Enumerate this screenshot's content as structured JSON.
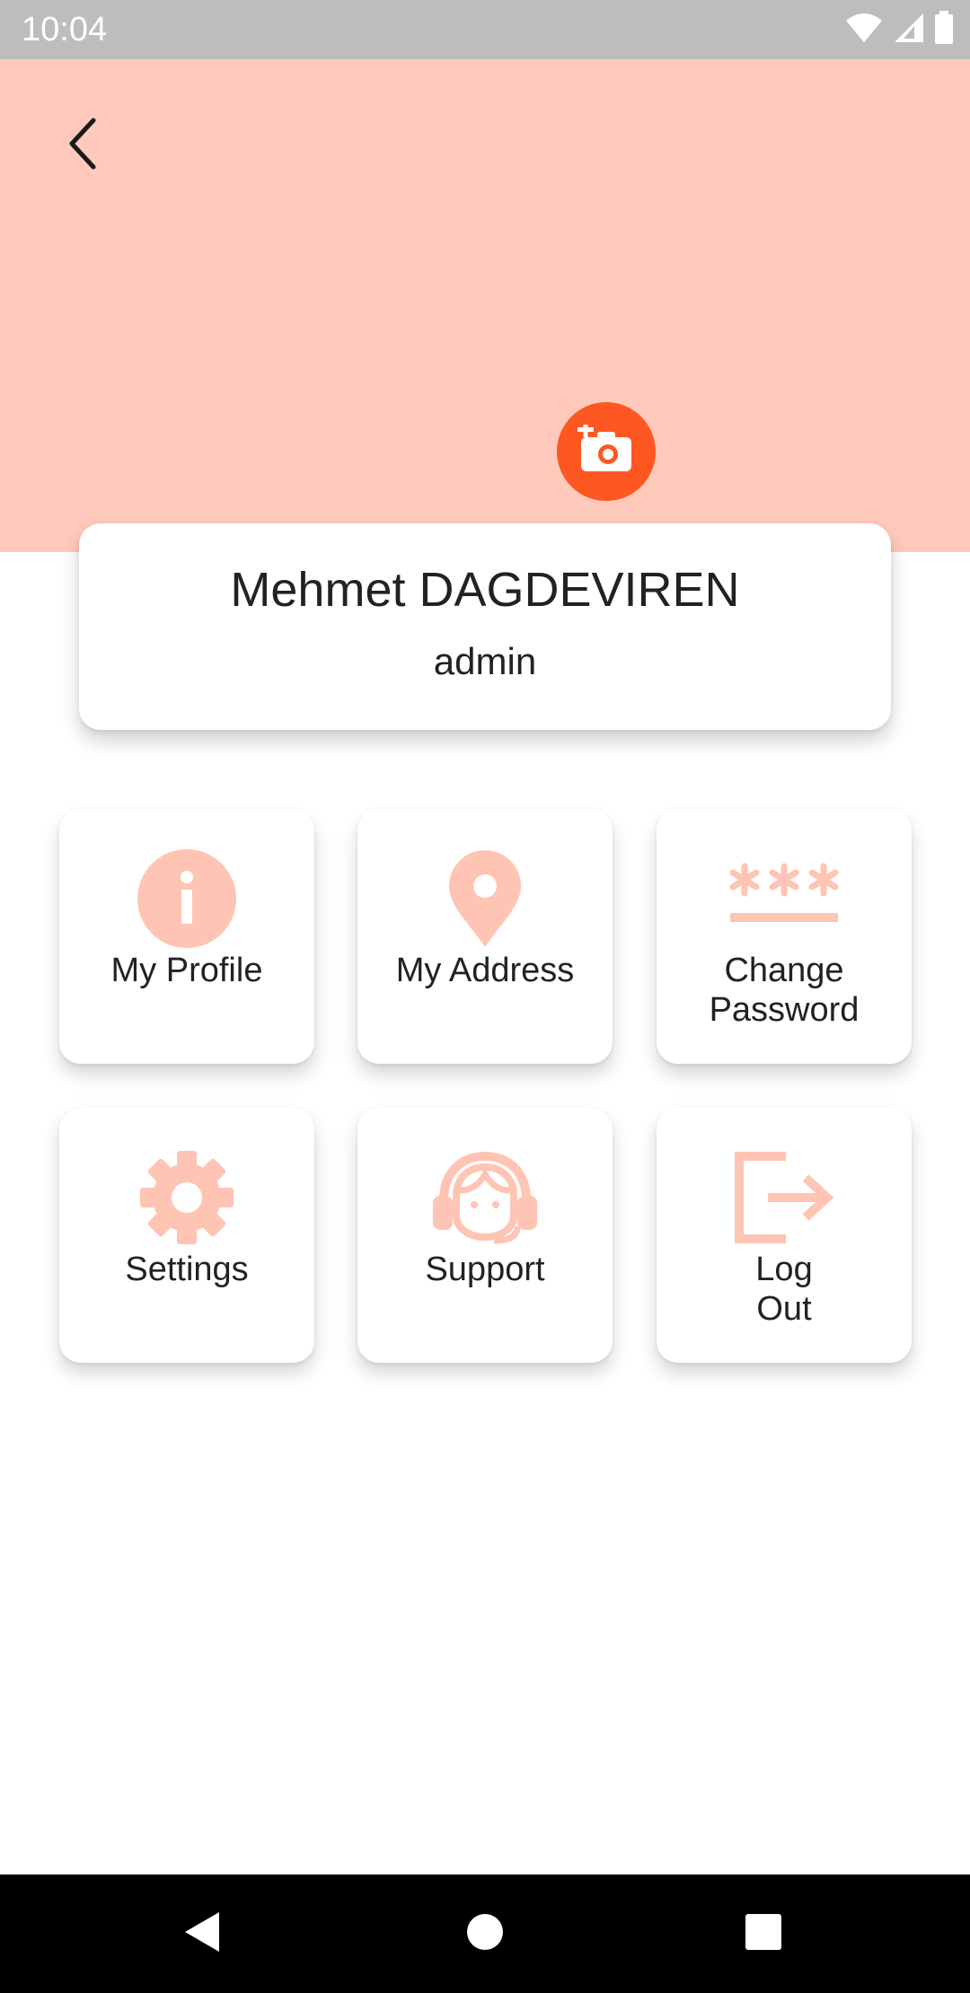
{
  "status_bar": {
    "time": "10:04",
    "icons": [
      "wifi-icon",
      "cell-signal-icon",
      "battery-icon"
    ]
  },
  "header": {
    "back_icon": "chevron-left-icon",
    "camera_icon": "add-photo-camera-icon"
  },
  "profile": {
    "name": "Mehmet DAGDEVIREN",
    "role": "admin"
  },
  "menu": {
    "items": [
      {
        "label": "My Profile",
        "icon": "info-icon"
      },
      {
        "label": "My Address",
        "icon": "location-pin-icon"
      },
      {
        "label": "Change\nPassword",
        "icon": "password-icon"
      },
      {
        "label": "Settings",
        "icon": "gear-icon"
      },
      {
        "label": "Support",
        "icon": "headset-support-icon"
      },
      {
        "label": "Log\nOut",
        "icon": "logout-icon"
      }
    ]
  },
  "nav": {
    "icons": [
      "back-triangle-icon",
      "home-circle-icon",
      "recents-square-icon"
    ]
  },
  "colors": {
    "header": "#ffcabb",
    "accent": "#ff5722",
    "tile_icon": "#ffc4b3",
    "status_bar": "#bdbdbd",
    "nav_bar": "#000000"
  }
}
